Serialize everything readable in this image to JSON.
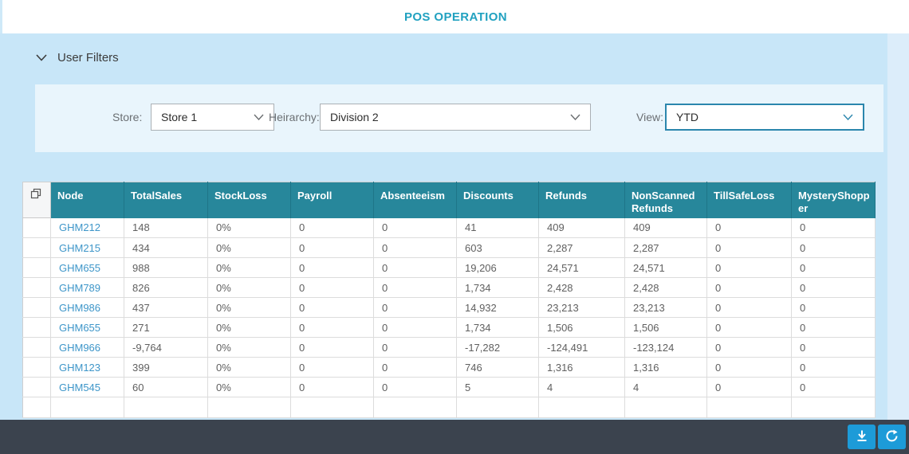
{
  "header": {
    "title": "POS OPERATION"
  },
  "filters": {
    "section_label": "User Filters",
    "fields": [
      {
        "label": "Store:",
        "value": "Store 1"
      },
      {
        "label": "Heirarchy:",
        "value": "Division 2"
      },
      {
        "label": "View:",
        "value": "YTD"
      }
    ]
  },
  "table": {
    "columns": [
      "Node",
      "TotalSales",
      "StockLoss",
      "Payroll",
      "Absenteeism",
      "Discounts",
      "Refunds",
      "NonScannedRefunds",
      "TillSafeLoss",
      "MysteryShopper"
    ],
    "rows": [
      [
        "GHM212",
        "148",
        "0%",
        "0",
        "0",
        "41",
        "409",
        "409",
        "0",
        "0"
      ],
      [
        "GHM215",
        "434",
        "0%",
        "0",
        "0",
        "603",
        "2,287",
        "2,287",
        "0",
        "0"
      ],
      [
        "GHM655",
        "988",
        "0%",
        "0",
        "0",
        "19,206",
        "24,571",
        "24,571",
        "0",
        "0"
      ],
      [
        "GHM789",
        "826",
        "0%",
        "0",
        "0",
        "1,734",
        "2,428",
        "2,428",
        "0",
        "0"
      ],
      [
        "GHM986",
        "437",
        "0%",
        "0",
        "0",
        "14,932",
        "23,213",
        "23,213",
        "0",
        "0"
      ],
      [
        "GHM655",
        "271",
        "0%",
        "0",
        "0",
        "1,734",
        "1,506",
        "1,506",
        "0",
        "0"
      ],
      [
        "GHM966",
        "-9,764",
        "0%",
        "0",
        "0",
        "-17,282",
        "-124,491",
        "-123,124",
        "0",
        "0"
      ],
      [
        "GHM123",
        "399",
        "0%",
        "0",
        "0",
        "746",
        "1,316",
        "1,316",
        "0",
        "0"
      ],
      [
        "GHM545",
        "60",
        "0%",
        "0",
        "0",
        "5",
        "4",
        "4",
        "0",
        "0"
      ]
    ]
  },
  "footer": {
    "buttons": [
      {
        "name": "download"
      },
      {
        "name": "refresh"
      }
    ]
  },
  "colors": {
    "title_teal": "#21a1c0",
    "table_header_teal": "#27879b",
    "page_blue": "#c8e6f8",
    "panel_blue": "#e9f5fc",
    "link_blue": "#3e96c9",
    "footer_dark": "#3b434e",
    "button_blue": "#1d9bd8",
    "view_select_border": "#2b86ad"
  }
}
